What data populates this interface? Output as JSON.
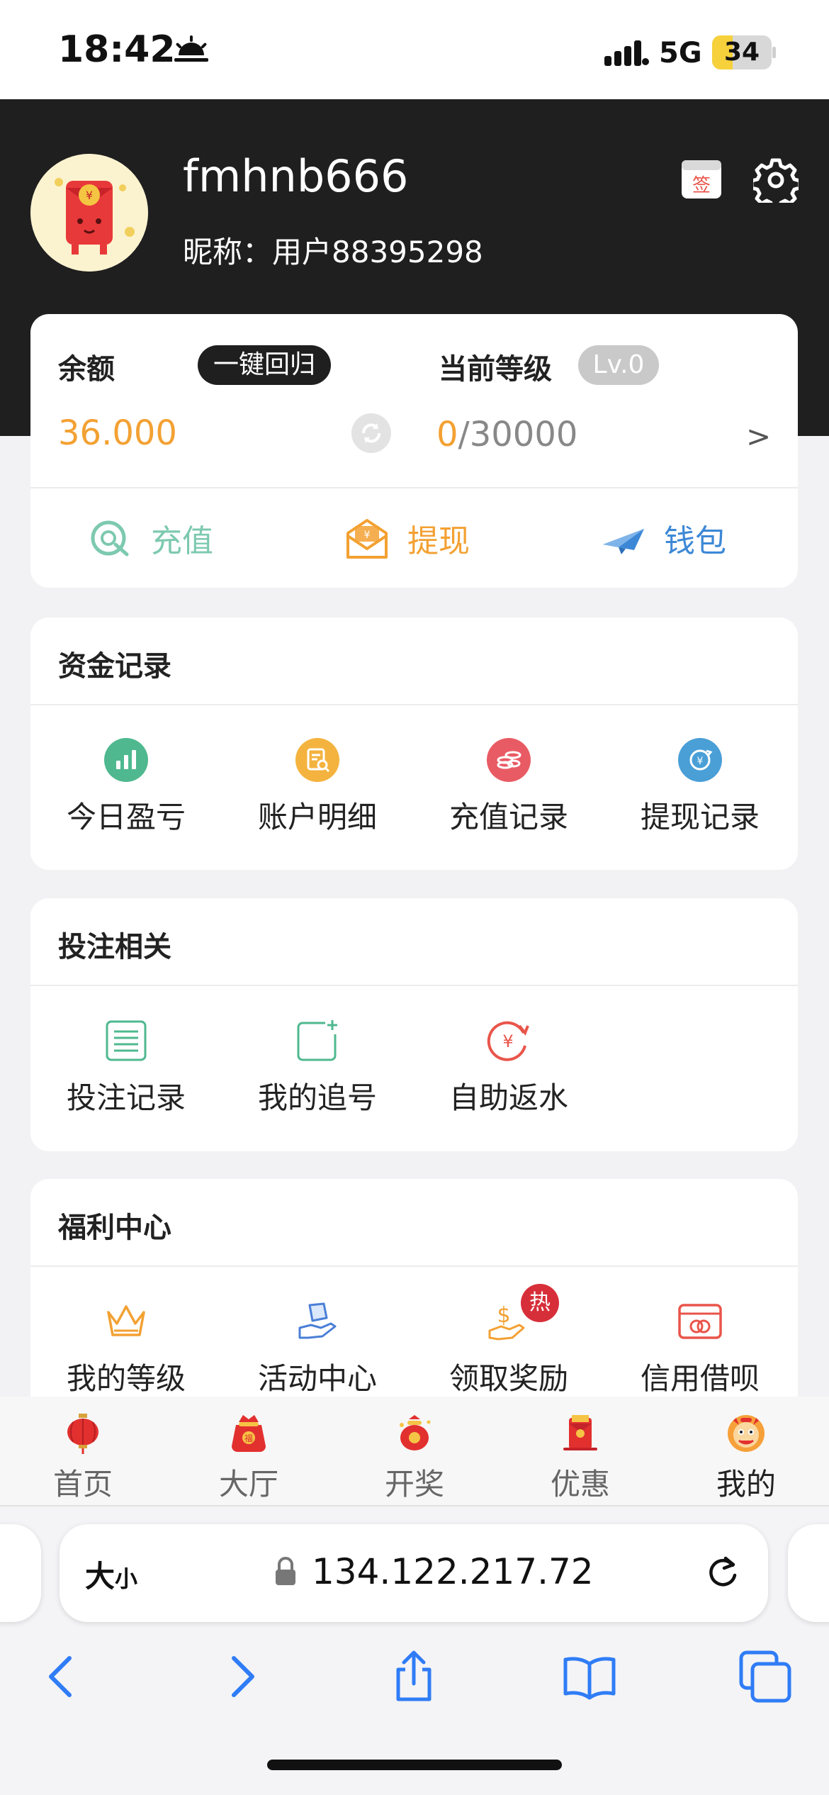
{
  "status_bar": {
    "time": "18:42",
    "network": "5G",
    "battery": "34",
    "battery_level": 0.34
  },
  "profile": {
    "username": "fmhnb666",
    "nickname": "昵称：用户88395298"
  },
  "balance": {
    "label": "余额",
    "recall_button": "一键回归",
    "amount": "36.000",
    "level_label": "当前等级",
    "level_badge": "Lv.0",
    "progress_current": "0",
    "progress_rest": "/30000",
    "more": ">"
  },
  "actions": [
    {
      "label": "充值",
      "color": "#7dc9b0",
      "icon": "recharge-icon"
    },
    {
      "label": "提现",
      "color": "#f3a133",
      "icon": "withdraw-envelope-icon"
    },
    {
      "label": "钱包",
      "color": "#3d88d6",
      "icon": "paper-plane-icon"
    }
  ],
  "funds": {
    "title": "资金记录",
    "items": [
      {
        "label": "今日盈亏",
        "icon": "bar-chart-icon",
        "color": "#4fb88f"
      },
      {
        "label": "账户明细",
        "icon": "document-search-icon",
        "color": "#f4b33f"
      },
      {
        "label": "充值记录",
        "icon": "coins-icon",
        "color": "#e95b64"
      },
      {
        "label": "提现记录",
        "icon": "yuan-refresh-icon",
        "color": "#4a9fd6"
      }
    ]
  },
  "betting": {
    "title": "投注相关",
    "items": [
      {
        "label": "投注记录",
        "icon": "list-icon",
        "color": "#4fb88f"
      },
      {
        "label": "我的追号",
        "icon": "add-square-icon",
        "color": "#4fb88f"
      },
      {
        "label": "自助返水",
        "icon": "yuan-cycle-icon",
        "color": "#e9554a"
      }
    ]
  },
  "welfare": {
    "title": "福利中心",
    "items": [
      {
        "label": "我的等级",
        "icon": "crown-icon",
        "color": "#f3a133"
      },
      {
        "label": "活动中心",
        "icon": "gift-hand-icon",
        "color": "#4a7fd6"
      },
      {
        "label": "领取奖励",
        "icon": "money-hand-icon",
        "color": "#f3a133",
        "badge": "热"
      },
      {
        "label": "信用借呗",
        "icon": "credit-card-icon",
        "color": "#e9554a"
      }
    ]
  },
  "tabbar": [
    {
      "label": "首页",
      "icon": "lantern-icon"
    },
    {
      "label": "大厅",
      "icon": "lucky-bag-icon"
    },
    {
      "label": "开奖",
      "icon": "red-bag-icon"
    },
    {
      "label": "优惠",
      "icon": "red-envelope-icon"
    },
    {
      "label": "我的",
      "icon": "lion-mascot-icon",
      "active": true
    }
  ],
  "browser": {
    "text_size": "大",
    "text_size_small": "小",
    "url": "134.122.217.72"
  }
}
